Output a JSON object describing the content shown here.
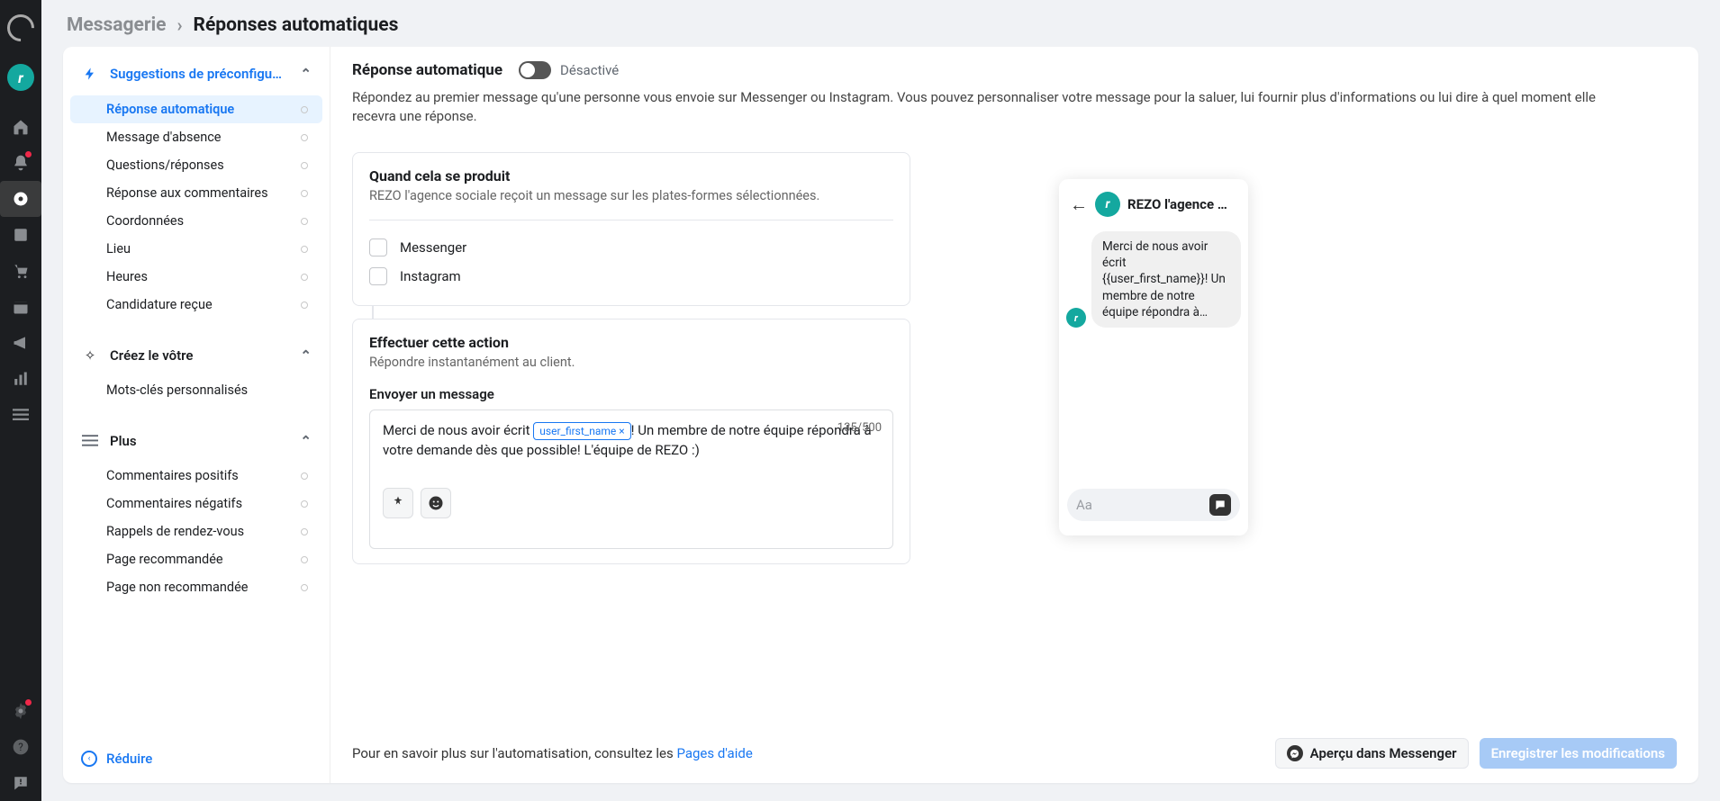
{
  "breadcrumb": {
    "level1": "Messagerie",
    "level2": "Réponses automatiques"
  },
  "brand": {
    "initial": "r"
  },
  "side_sections": {
    "suggestions": {
      "title": "Suggestions de préconfigu…",
      "items": [
        "Réponse automatique",
        "Message d'absence",
        "Questions/réponses",
        "Réponse aux commentaires",
        "Coordonnées",
        "Lieu",
        "Heures",
        "Candidature reçue"
      ]
    },
    "create": {
      "title": "Créez le vôtre",
      "items": [
        "Mots-clés personnalisés"
      ]
    },
    "more": {
      "title": "Plus",
      "items": [
        "Commentaires positifs",
        "Commentaires négatifs",
        "Rappels de rendez-vous",
        "Page recommandée",
        "Page non recommandée"
      ]
    }
  },
  "reduce": "Réduire",
  "header": {
    "title": "Réponse automatique",
    "toggle_state": "Désactivé",
    "description": "Répondez au premier message qu'une personne vous envoie sur Messenger ou Instagram. Vous pouvez personnaliser votre message pour la saluer, lui fournir plus d'informations ou lui dire à quel moment elle recevra une réponse."
  },
  "cards": {
    "when": {
      "title": "Quand cela se produit",
      "sub": "REZO l'agence sociale reçoit un message sur les plates-formes sélectionnées.",
      "platforms": {
        "messenger": "Messenger",
        "instagram": "Instagram"
      }
    },
    "action": {
      "title": "Effectuer cette action",
      "sub": "Répondre instantanément au client.",
      "field_label": "Envoyer un message",
      "message_before": "Merci de nous avoir écrit ",
      "tag": "user_first_name ×",
      "message_after": "! Un membre de notre équipe répondra à votre demande dès que possible! L'équipe de REZO :)",
      "counter": "135/500"
    }
  },
  "preview": {
    "name": "REZO l'agence …",
    "bubble": "Merci de nous avoir écrit {{user_first_name}}! Un membre de notre équipe répondra à…",
    "placeholder": "Aa"
  },
  "footer": {
    "text": "Pour en savoir plus sur l'automatisation, consultez les ",
    "link": "Pages d'aide",
    "preview_btn": "Aperçu dans Messenger",
    "save_btn": "Enregistrer les modifications"
  }
}
